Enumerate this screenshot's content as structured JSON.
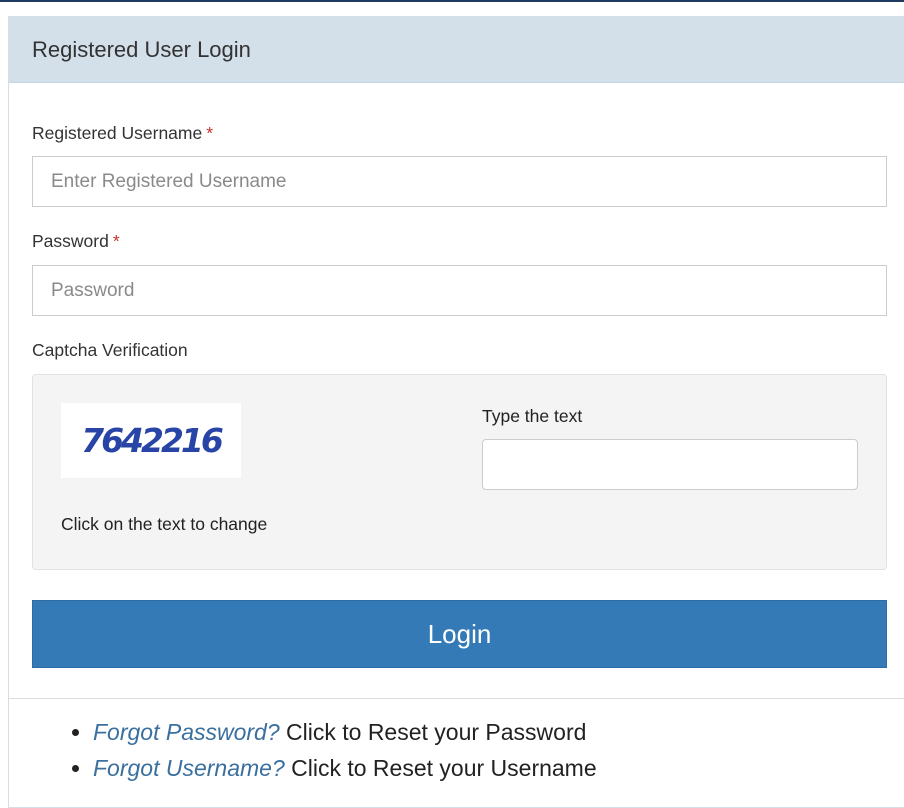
{
  "panel": {
    "title": "Registered User Login"
  },
  "form": {
    "username": {
      "label": "Registered Username",
      "required_mark": "*",
      "placeholder": "Enter Registered Username",
      "value": ""
    },
    "password": {
      "label": "Password",
      "required_mark": "*",
      "placeholder": "Password",
      "value": ""
    },
    "captcha": {
      "section_label": "Captcha Verification",
      "image_text": "7642216",
      "change_hint": "Click on the text to change",
      "type_label": "Type the text",
      "value": ""
    },
    "login_label": "Login"
  },
  "links": [
    {
      "link_text": "Forgot Password?",
      "description": " Click to Reset your Password"
    },
    {
      "link_text": "Forgot Username?",
      "description": " Click to Reset your Username"
    }
  ],
  "colors": {
    "heading_bg": "#d3dfe9",
    "button_bg": "#337ab7",
    "link": "#3a6f9e",
    "required": "#c9302c",
    "captcha_text": "#2744a6"
  }
}
